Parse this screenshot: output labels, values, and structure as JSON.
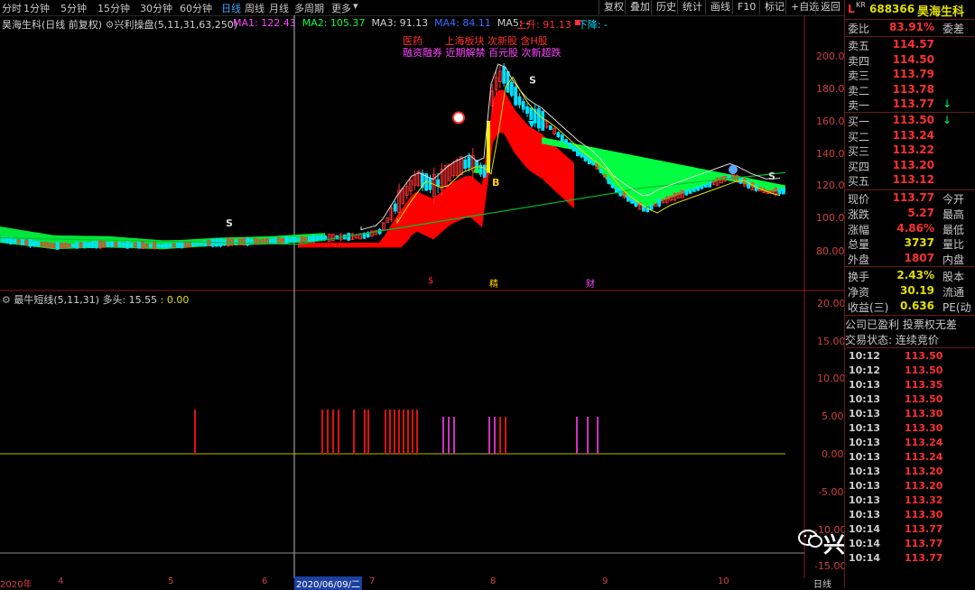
{
  "toolbar": {
    "timeframes": [
      "分时",
      "1分钟",
      "5分钟",
      "15分钟",
      "30分钟",
      "60分钟",
      "日线",
      "周线",
      "月线",
      "多周期",
      "更多"
    ],
    "active": "日线",
    "buttons": [
      "复权",
      "叠加",
      "历史",
      "统计",
      "画线",
      "F10",
      "标记",
      "+自选",
      "返回"
    ]
  },
  "chart_header": {
    "stock": "昊海生科",
    "mode": "(日线 前复权)",
    "indicator": "兴利操盘",
    "params": "(5,11,31,63,250)",
    "ma1": "MA1: 122.43",
    "ma2": "MA2: 105.37",
    "ma3": "MA3: 91.13",
    "ma4": "MA4: 84.11",
    "ma5": "MA5: -",
    "up": "上升: 91.13",
    "down": "下降: -"
  },
  "annotations": {
    "line1": [
      "医药",
      "上海板块",
      "次新股",
      "含H股"
    ],
    "line2": [
      "融资融券",
      "近期解禁",
      "百元股",
      "次新超跌"
    ],
    "markers": [
      "S",
      "S",
      "S",
      "B",
      "S"
    ],
    "bottom_marks": [
      "$",
      "精",
      "财"
    ]
  },
  "main_axis": [
    "200.0",
    "180.0",
    "160.0",
    "140.0",
    "120.0",
    "100.0",
    "80.00"
  ],
  "sub_header": {
    "name": "最牛短线",
    "params": "(5,11,31)",
    "state_label": "多头:",
    "value1": "15.55",
    "value2": ": 0.00"
  },
  "sub_axis": [
    "20.00",
    "15.00",
    "10.00",
    "5.00",
    "0.00",
    "-5.00",
    "-10.00",
    "-15.00"
  ],
  "time_axis": {
    "labels": [
      "2020年",
      "4",
      "5",
      "6",
      "7",
      "8",
      "9",
      "10"
    ],
    "cursor_date": "2020/06/09/二",
    "period": "日线"
  },
  "panel": {
    "code": "688366",
    "name": "昊海生科",
    "flag": "L",
    "flag_sup": "KR",
    "ratio_label": "委比",
    "ratio_value": "83.91%",
    "ratio_right": "委差",
    "asks": [
      {
        "label": "卖五",
        "price": "114.57"
      },
      {
        "label": "卖四",
        "price": "114.50"
      },
      {
        "label": "卖三",
        "price": "113.79"
      },
      {
        "label": "卖二",
        "price": "113.78"
      },
      {
        "label": "卖一",
        "price": "113.77",
        "arrow": "↓"
      }
    ],
    "bids": [
      {
        "label": "买一",
        "price": "113.50",
        "arrow": "↓"
      },
      {
        "label": "买二",
        "price": "113.24"
      },
      {
        "label": "买三",
        "price": "113.22"
      },
      {
        "label": "买四",
        "price": "113.20"
      },
      {
        "label": "买五",
        "price": "113.12"
      }
    ],
    "stats": [
      {
        "label": "现价",
        "value": "113.77",
        "right": "今开",
        "color": "#ff3030"
      },
      {
        "label": "涨跌",
        "value": "5.27",
        "right": "最高",
        "color": "#ff3030"
      },
      {
        "label": "涨幅",
        "value": "4.86%",
        "right": "最低",
        "color": "#ff3030"
      },
      {
        "label": "总量",
        "value": "3737",
        "right": "量比",
        "color": "#e0e000"
      },
      {
        "label": "外盘",
        "value": "1807",
        "right": "内盘",
        "color": "#ff3030"
      }
    ],
    "stats2": [
      {
        "label": "换手",
        "value": "2.43%",
        "right": "股本"
      },
      {
        "label": "净资",
        "value": "30.19",
        "right": "流通"
      },
      {
        "label": "收益(三)",
        "value": "0.636",
        "right": "PE(动"
      }
    ],
    "info1": "公司已盈利 投票权无差",
    "info2": "交易状态: 连续竞价",
    "ticks": [
      {
        "t": "10:12",
        "p": "113.50"
      },
      {
        "t": "10:12",
        "p": "113.50"
      },
      {
        "t": "10:13",
        "p": "113.35"
      },
      {
        "t": "10:13",
        "p": "113.50"
      },
      {
        "t": "10:13",
        "p": "113.30"
      },
      {
        "t": "10:13",
        "p": "113.30"
      },
      {
        "t": "10:13",
        "p": "113.24"
      },
      {
        "t": "10:13",
        "p": "113.24"
      },
      {
        "t": "10:13",
        "p": "113.20"
      },
      {
        "t": "10:13",
        "p": "113.20"
      },
      {
        "t": "10:13",
        "p": "113.32"
      },
      {
        "t": "10:13",
        "p": "113.30"
      },
      {
        "t": "10:14",
        "p": "113.77"
      },
      {
        "t": "10:14",
        "p": "113.77"
      },
      {
        "t": "10:14",
        "p": "113.77"
      }
    ]
  },
  "watermark": "兴利炒股",
  "colors": {
    "up": "#ff3030",
    "down": "#00e0ff",
    "ma_green": "#00ff40",
    "ribbon_red": "#ff0000",
    "pink": "#ff44cc",
    "yellow": "#e0e000",
    "panel_border": "#6b1a1a"
  }
}
